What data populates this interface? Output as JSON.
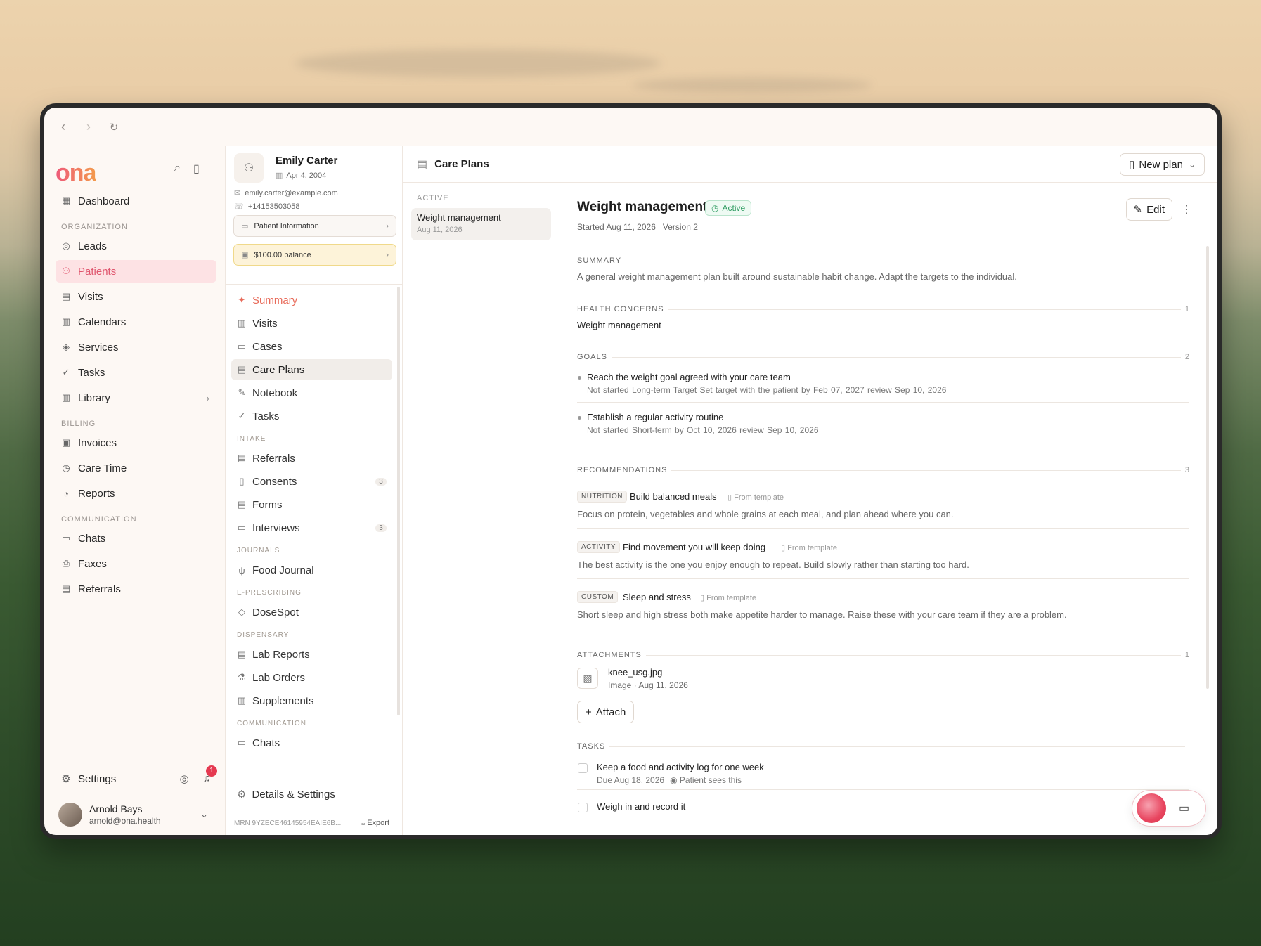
{
  "browser": {
    "back": "‹",
    "forward": "›",
    "reload": "↻"
  },
  "sidebar": {
    "logo": "ona",
    "tools": {
      "search_icon": "⌕",
      "panel_icon": "▯"
    },
    "items_top": [
      {
        "label": "Dashboard",
        "icon": "▦"
      }
    ],
    "sections": [
      {
        "title": "ORGANIZATION",
        "items": [
          {
            "label": "Leads",
            "icon": "◎"
          },
          {
            "label": "Patients",
            "icon": "⚇",
            "active": true
          },
          {
            "label": "Visits",
            "icon": "▤"
          },
          {
            "label": "Calendars",
            "icon": "▥"
          },
          {
            "label": "Services",
            "icon": "◈"
          },
          {
            "label": "Tasks",
            "icon": "✓"
          },
          {
            "label": "Library",
            "icon": "▥",
            "chevron": "›"
          }
        ]
      },
      {
        "title": "BILLING",
        "items": [
          {
            "label": "Invoices",
            "icon": "▣"
          },
          {
            "label": "Care Time",
            "icon": "◷"
          },
          {
            "label": "Reports",
            "icon": "◔"
          }
        ]
      },
      {
        "title": "COMMUNICATION",
        "items": [
          {
            "label": "Chats",
            "icon": "▭"
          },
          {
            "label": "Faxes",
            "icon": "⎙"
          },
          {
            "label": "Referrals",
            "icon": "▤"
          }
        ]
      }
    ],
    "settings_label": "Settings",
    "notifications_count": "1",
    "user": {
      "name": "Arnold Bays",
      "email": "arnold@ona.health"
    }
  },
  "patient": {
    "name": "Emily Carter",
    "dob": "Apr 4, 2004",
    "email": "emily.carter@example.com",
    "phone": "+14153503058",
    "info_button": "Patient Information",
    "balance": "$100.00 balance",
    "menu": [
      {
        "label": "Summary",
        "icon": "✦",
        "cls": "summary"
      },
      {
        "label": "Visits",
        "icon": "▥"
      },
      {
        "label": "Cases",
        "icon": "▭"
      },
      {
        "label": "Care Plans",
        "icon": "▤",
        "cls": "active"
      },
      {
        "label": "Notebook",
        "icon": "✎"
      },
      {
        "label": "Tasks",
        "icon": "✓"
      }
    ],
    "sections": [
      {
        "title": "INTAKE",
        "items": [
          {
            "label": "Referrals",
            "icon": "▤"
          },
          {
            "label": "Consents",
            "icon": "▯",
            "count": "3"
          },
          {
            "label": "Forms",
            "icon": "▤"
          },
          {
            "label": "Interviews",
            "icon": "▭",
            "count": "3"
          }
        ]
      },
      {
        "title": "JOURNALS",
        "items": [
          {
            "label": "Food Journal",
            "icon": "ψ"
          }
        ]
      },
      {
        "title": "E-PRESCRIBING",
        "items": [
          {
            "label": "DoseSpot",
            "icon": "◇"
          }
        ]
      },
      {
        "title": "DISPENSARY",
        "items": [
          {
            "label": "Lab Reports",
            "icon": "▤"
          },
          {
            "label": "Lab Orders",
            "icon": "⚗"
          },
          {
            "label": "Supplements",
            "icon": "▥"
          }
        ]
      },
      {
        "title": "COMMUNICATION",
        "items": [
          {
            "label": "Chats",
            "icon": "▭"
          }
        ]
      }
    ],
    "details_label": "Details & Settings",
    "mrn": "MRN 9YZECE46145954EAIE6B...",
    "export_label": "Export"
  },
  "care_plans": {
    "header_title": "Care Plans",
    "new_plan_label": "New plan",
    "list_section": "ACTIVE",
    "list": [
      {
        "name": "Weight management",
        "date": "Aug 11, 2026"
      }
    ]
  },
  "detail": {
    "title": "Weight management",
    "status": "Active",
    "started": "Started Aug 11, 2026",
    "version": "Version 2",
    "edit_label": "Edit",
    "summary_heading": "SUMMARY",
    "summary_text": "A general weight management plan built around sustainable habit change. Adapt the targets to the individual.",
    "concerns_heading": "HEALTH CONCERNS",
    "concerns_count": "1",
    "concern": "Weight management",
    "goals_heading": "GOALS",
    "goals_count": "2",
    "goals": [
      {
        "title": "Reach the weight goal agreed with your care team",
        "meta": "Not started   Long-term   Target Set target with the patient   by Feb 07, 2027   review Sep 10, 2026"
      },
      {
        "title": "Establish a regular activity routine",
        "meta": "Not started   Short-term   by Oct 10, 2026   review Sep 10, 2026"
      }
    ],
    "recs_heading": "RECOMMENDATIONS",
    "recs_count": "3",
    "recommendations": [
      {
        "tag": "NUTRITION",
        "title": "Build balanced meals",
        "source": "From template",
        "desc": "Focus on protein, vegetables and whole grains at each meal, and plan ahead where you can."
      },
      {
        "tag": "ACTIVITY",
        "title": "Find movement you will keep doing",
        "source": "From template",
        "desc": "The best activity is the one you enjoy enough to repeat. Build slowly rather than starting too hard."
      },
      {
        "tag": "CUSTOM",
        "title": "Sleep and stress",
        "source": "From template",
        "desc": "Short sleep and high stress both make appetite harder to manage. Raise these with your care team if they are a problem."
      }
    ],
    "attachments_heading": "ATTACHMENTS",
    "attachments_count": "1",
    "attachment": {
      "name": "knee_usg.jpg",
      "meta": "Image · Aug 11, 2026"
    },
    "attach_label": "Attach",
    "tasks_heading": "TASKS",
    "tasks": [
      {
        "title": "Keep a food and activity log for one week",
        "due": "Due Aug 18, 2026",
        "visibility": "Patient sees this"
      },
      {
        "title": "Weigh in and record it"
      }
    ]
  }
}
